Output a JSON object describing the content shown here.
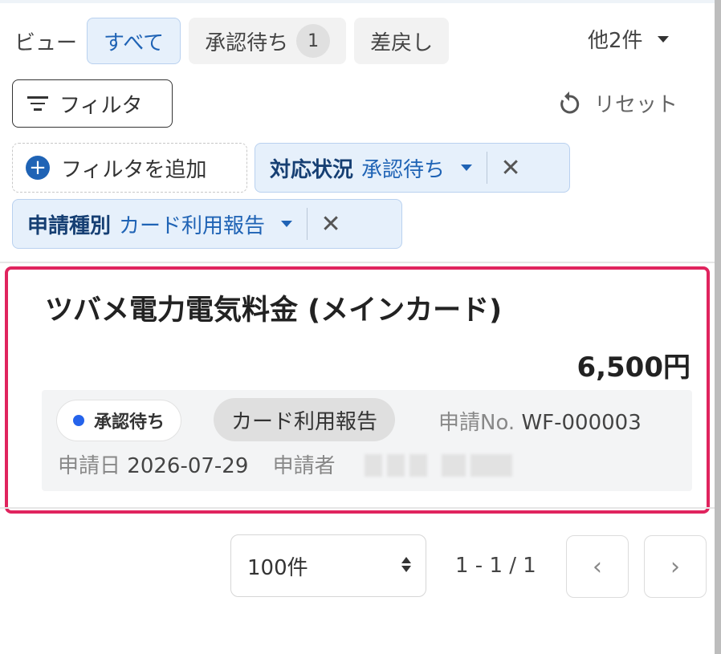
{
  "views": {
    "label": "ビュー",
    "tabs": [
      {
        "label": "すべて",
        "active": true
      },
      {
        "label": "承認待ち",
        "count": "1"
      },
      {
        "label": "差戻し"
      }
    ],
    "more": "他2件"
  },
  "filter": {
    "button_label": "フィルタ",
    "reset_label": "リセット",
    "add_label": "フィルタを追加",
    "chips": [
      {
        "key": "対応状況",
        "value": "承認待ち"
      },
      {
        "key": "申請種別",
        "value": "カード利用報告"
      }
    ]
  },
  "item": {
    "title": "ツバメ電力電気料金 (メインカード)",
    "amount": "6,500円",
    "status": "承認待ち",
    "status_color": "#2563eb",
    "type": "カード利用報告",
    "app_no_label": "申請No.",
    "app_no": "WF-000003",
    "date_label": "申請日",
    "date": "2026-07-29",
    "applicant_label": "申請者"
  },
  "pagination": {
    "per_page": "100件",
    "range": "1 - 1 / 1"
  },
  "colors": {
    "accent": "#1f63b5",
    "highlight_border": "#e0245e"
  }
}
